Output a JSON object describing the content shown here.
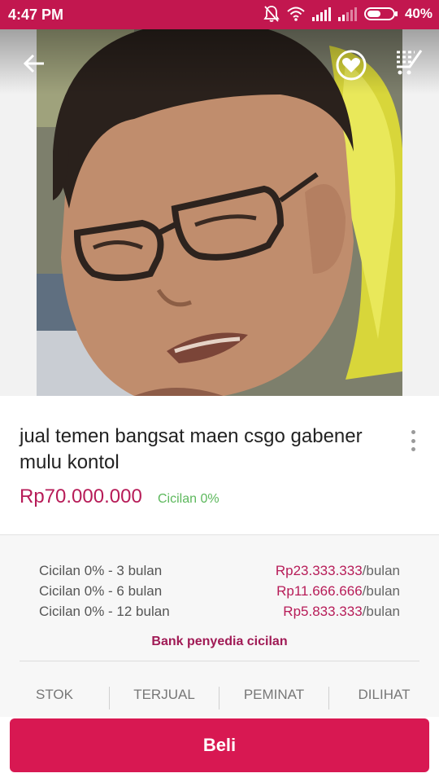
{
  "status_bar": {
    "time": "4:47 PM",
    "battery": "40%",
    "icons": [
      "mute-bell-icon",
      "wifi-icon",
      "signal-icon",
      "signal-weak-icon",
      "battery-icon"
    ]
  },
  "colors": {
    "status_bar": "#c2174f",
    "accent": "#b71c58",
    "cta": "#d81852",
    "installment_tag": "#5cb85c"
  },
  "toolbar": {
    "back_icon": "back-arrow-icon",
    "wishlist_icon": "heart-icon",
    "cart_icon": "cart-icon"
  },
  "product": {
    "title": "jual temen bangsat maen csgo gabener mulu kontol",
    "price": "Rp70.000.000",
    "installment_tag": "Cicilan 0%"
  },
  "installments": [
    {
      "label": "Cicilan 0% - 3 bulan",
      "amount": "Rp23.333.333",
      "unit": "/bulan"
    },
    {
      "label": "Cicilan 0% - 6 bulan",
      "amount": "Rp11.666.666",
      "unit": "/bulan"
    },
    {
      "label": "Cicilan 0% - 12 bulan",
      "amount": "Rp5.833.333",
      "unit": "/bulan"
    }
  ],
  "bank_link": "Bank penyedia cicilan",
  "stats": [
    "STOK",
    "TERJUAL",
    "PEMINAT",
    "DILIHAT"
  ],
  "buy_button": "Beli"
}
